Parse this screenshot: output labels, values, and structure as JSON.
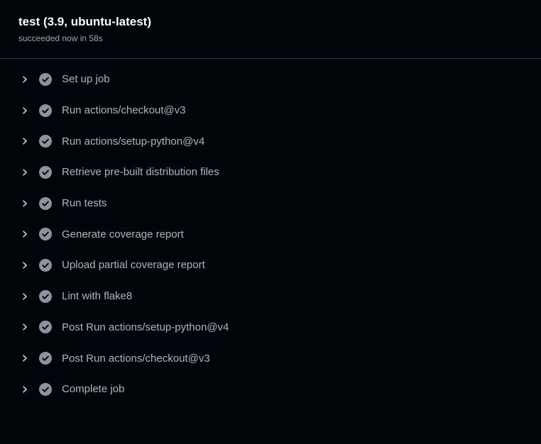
{
  "job": {
    "title": "test (3.9, ubuntu-latest)",
    "status": "succeeded now in 58s"
  },
  "colors": {
    "background": "#010409",
    "success_icon": "#8b949e",
    "text_muted": "#adb6c0"
  },
  "steps": [
    {
      "label": "Set up job",
      "status_icon": "check-circle-icon",
      "expand_icon": "chevron-right-icon"
    },
    {
      "label": "Run actions/checkout@v3",
      "status_icon": "check-circle-icon",
      "expand_icon": "chevron-right-icon"
    },
    {
      "label": "Run actions/setup-python@v4",
      "status_icon": "check-circle-icon",
      "expand_icon": "chevron-right-icon"
    },
    {
      "label": "Retrieve pre-built distribution files",
      "status_icon": "check-circle-icon",
      "expand_icon": "chevron-right-icon"
    },
    {
      "label": "Run tests",
      "status_icon": "check-circle-icon",
      "expand_icon": "chevron-right-icon"
    },
    {
      "label": "Generate coverage report",
      "status_icon": "check-circle-icon",
      "expand_icon": "chevron-right-icon"
    },
    {
      "label": "Upload partial coverage report",
      "status_icon": "check-circle-icon",
      "expand_icon": "chevron-right-icon"
    },
    {
      "label": "Lint with flake8",
      "status_icon": "check-circle-icon",
      "expand_icon": "chevron-right-icon"
    },
    {
      "label": "Post Run actions/setup-python@v4",
      "status_icon": "check-circle-icon",
      "expand_icon": "chevron-right-icon"
    },
    {
      "label": "Post Run actions/checkout@v3",
      "status_icon": "check-circle-icon",
      "expand_icon": "chevron-right-icon"
    },
    {
      "label": "Complete job",
      "status_icon": "check-circle-icon",
      "expand_icon": "chevron-right-icon"
    }
  ]
}
